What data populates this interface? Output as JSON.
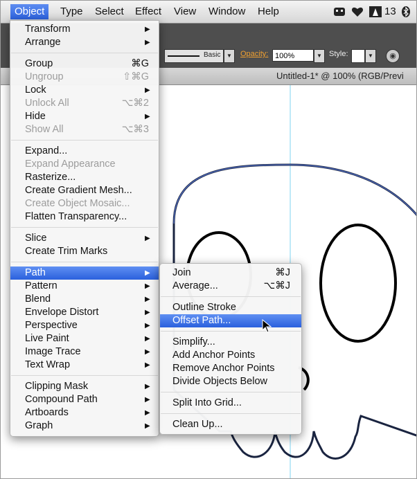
{
  "menubar": {
    "items": [
      "Object",
      "Type",
      "Select",
      "Effect",
      "View",
      "Window",
      "Help"
    ],
    "active_index": 0,
    "status_count": "13"
  },
  "controlbar": {
    "stroke_profile": "Basic",
    "opacity_label": "Opacity:",
    "opacity_value": "100%",
    "style_label": "Style:"
  },
  "document": {
    "tab_title": "Untitled-1* @ 100% (RGB/Previ"
  },
  "object_menu": {
    "items": [
      {
        "label": "Transform",
        "submenu": true
      },
      {
        "label": "Arrange",
        "submenu": true
      },
      {
        "label": "Group",
        "shortcut": "⌘G"
      },
      {
        "label": "Ungroup",
        "shortcut": "⇧⌘G",
        "disabled": true
      },
      {
        "label": "Lock",
        "submenu": true
      },
      {
        "label": "Unlock All",
        "shortcut": "⌥⌘2",
        "disabled": true
      },
      {
        "label": "Hide",
        "submenu": true
      },
      {
        "label": "Show All",
        "shortcut": "⌥⌘3",
        "disabled": true
      },
      {
        "label": "Expand..."
      },
      {
        "label": "Expand Appearance",
        "disabled": true
      },
      {
        "label": "Rasterize..."
      },
      {
        "label": "Create Gradient Mesh..."
      },
      {
        "label": "Create Object Mosaic...",
        "disabled": true
      },
      {
        "label": "Flatten Transparency..."
      },
      {
        "label": "Slice",
        "submenu": true
      },
      {
        "label": "Create Trim Marks"
      },
      {
        "label": "Path",
        "submenu": true,
        "highlighted": true
      },
      {
        "label": "Pattern",
        "submenu": true
      },
      {
        "label": "Blend",
        "submenu": true
      },
      {
        "label": "Envelope Distort",
        "submenu": true
      },
      {
        "label": "Perspective",
        "submenu": true
      },
      {
        "label": "Live Paint",
        "submenu": true
      },
      {
        "label": "Image Trace",
        "submenu": true
      },
      {
        "label": "Text Wrap",
        "submenu": true
      },
      {
        "label": "Clipping Mask",
        "submenu": true
      },
      {
        "label": "Compound Path",
        "submenu": true
      },
      {
        "label": "Artboards",
        "submenu": true
      },
      {
        "label": "Graph",
        "submenu": true
      }
    ]
  },
  "path_submenu": {
    "items": [
      {
        "label": "Join",
        "shortcut": "⌘J"
      },
      {
        "label": "Average...",
        "shortcut": "⌥⌘J"
      },
      {
        "label": "Outline Stroke"
      },
      {
        "label": "Offset Path...",
        "highlighted": true
      },
      {
        "label": "Simplify..."
      },
      {
        "label": "Add Anchor Points"
      },
      {
        "label": "Remove Anchor Points"
      },
      {
        "label": "Divide Objects Below"
      },
      {
        "label": "Split Into Grid..."
      },
      {
        "label": "Clean Up..."
      }
    ]
  },
  "colors": {
    "highlight": "#2d63e0",
    "guide": "#7fd3f2",
    "disabled_text": "#9c9c9c"
  }
}
